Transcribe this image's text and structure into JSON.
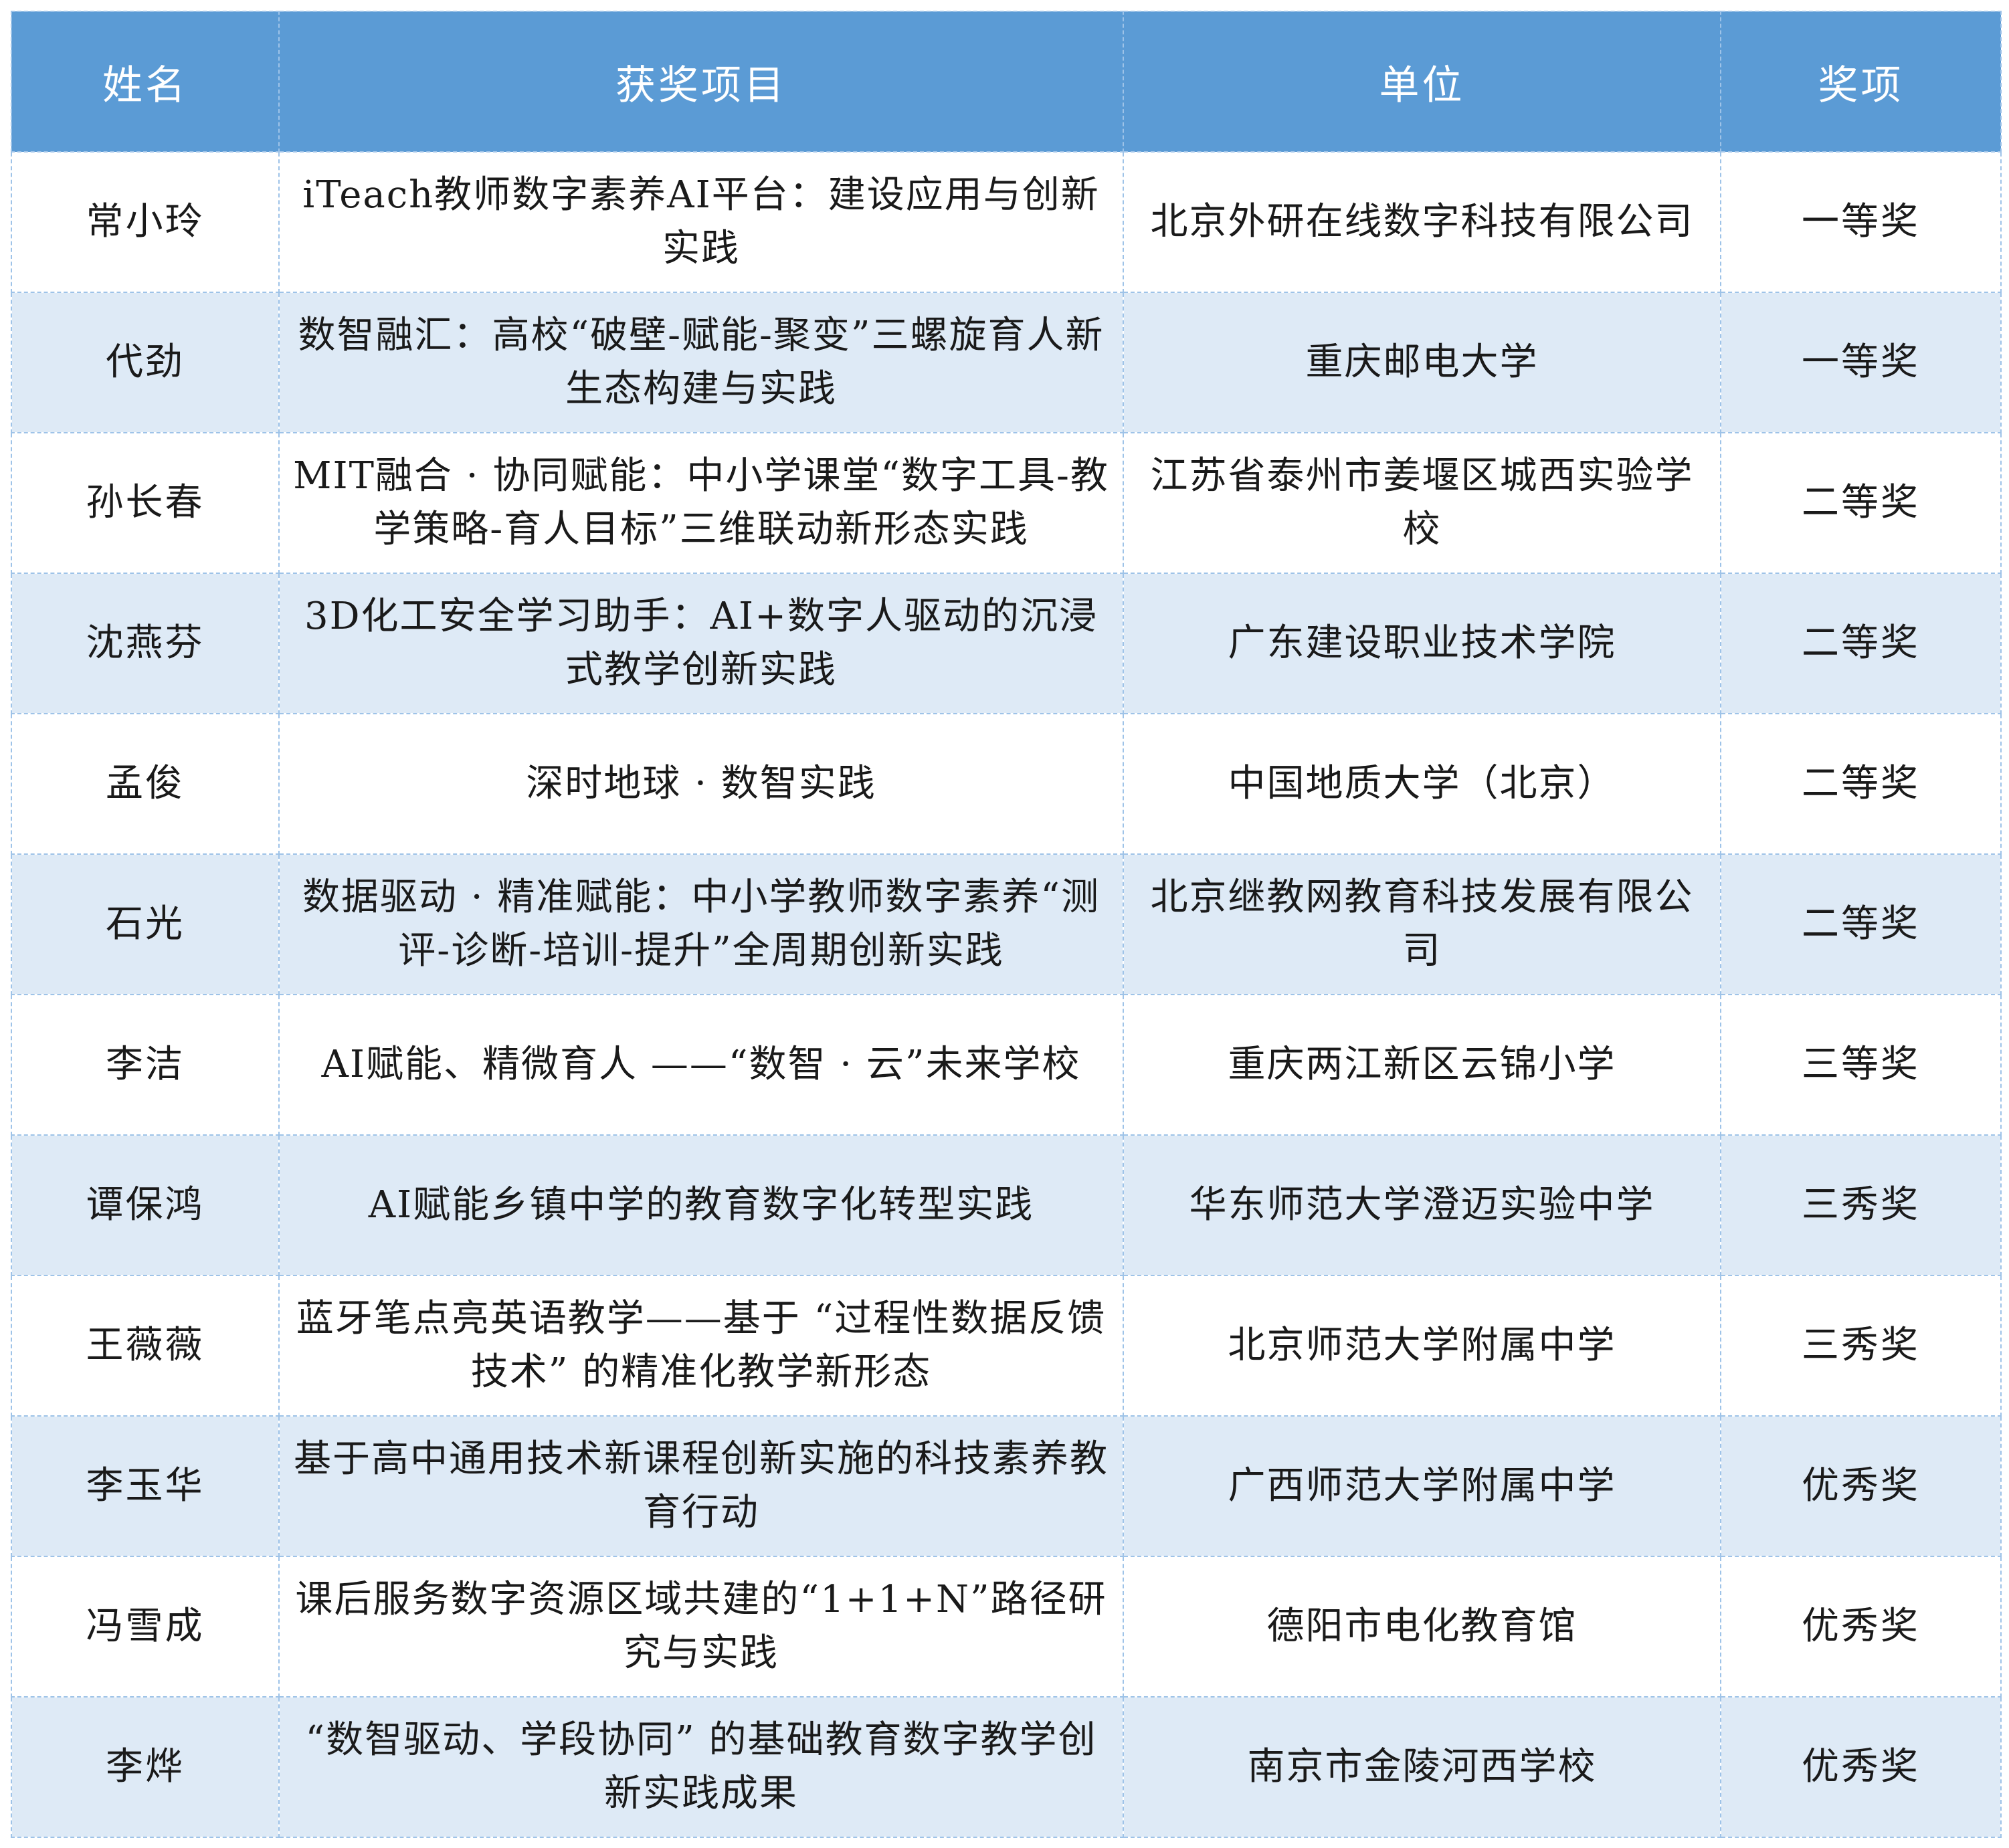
{
  "table": {
    "headers": {
      "name": "姓名",
      "project": "获奖项目",
      "unit": "单位",
      "award": "奖项"
    },
    "rows": [
      {
        "name": "常小玲",
        "project": "iTeach教师数字素养AI平台：建设应用与创新实践",
        "unit": "北京外研在线数字科技有限公司",
        "award": "一等奖"
      },
      {
        "name": "代劲",
        "project": "数智融汇：高校“破壁-赋能-聚变”三螺旋育人新生态构建与实践",
        "unit": "重庆邮电大学",
        "award": "一等奖"
      },
      {
        "name": "孙长春",
        "project": "MIT融合 · 协同赋能：中小学课堂“数字工具-教学策略-育人目标”三维联动新形态实践",
        "unit": "江苏省泰州市姜堰区城西实验学校",
        "award": "二等奖"
      },
      {
        "name": "沈燕芬",
        "project": "3D化工安全学习助手：AI+数字人驱动的沉浸式教学创新实践",
        "unit": "广东建设职业技术学院",
        "award": "二等奖"
      },
      {
        "name": "孟俊",
        "project": "深时地球 · 数智实践",
        "unit": "中国地质大学（北京）",
        "award": "二等奖"
      },
      {
        "name": "石光",
        "project": "数据驱动 · 精准赋能：中小学教师数字素养“测评-诊断-培训-提升”全周期创新实践",
        "unit": "北京继教网教育科技发展有限公司",
        "award": "二等奖"
      },
      {
        "name": "李洁",
        "project": "AI赋能、精微育人 ——“数智 · 云”未来学校",
        "unit": "重庆两江新区云锦小学",
        "award": "三等奖"
      },
      {
        "name": "谭保鸿",
        "project": "AI赋能乡镇中学的教育数字化转型实践",
        "unit": "华东师范大学澄迈实验中学",
        "award": "三秀奖"
      },
      {
        "name": "王薇薇",
        "project": "蓝牙笔点亮英语教学——基于 “过程性数据反馈技术” 的精准化教学新形态",
        "unit": "北京师范大学附属中学",
        "award": "三秀奖"
      },
      {
        "name": "李玉华",
        "project": "基于高中通用技术新课程创新实施的科技素养教育行动",
        "unit": "广西师范大学附属中学",
        "award": "优秀奖"
      },
      {
        "name": "冯雪成",
        "project": "课后服务数字资源区域共建的“1+1+N”路径研究与实践",
        "unit": "德阳市电化教育馆",
        "award": "优秀奖"
      },
      {
        "name": "李烨",
        "project": "“数智驱动、学段协同” 的基础教育数字教学创新实践成果",
        "unit": "南京市金陵河西学校",
        "award": "优秀奖"
      }
    ]
  }
}
